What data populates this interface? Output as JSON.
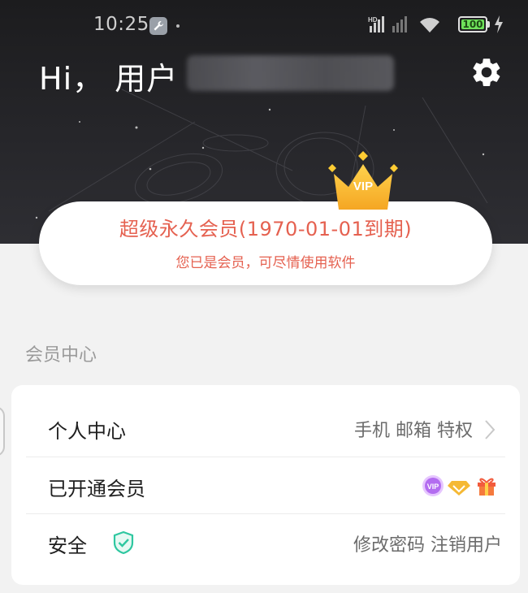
{
  "status_bar": {
    "time": "10:25",
    "battery": "100",
    "network_badge": "HD"
  },
  "header": {
    "greeting": "Hi，  用户",
    "icons": [
      "settings-icon"
    ]
  },
  "membership": {
    "title": "超级永久会员(1970-01-01到期)",
    "description": "您已是会员，可尽情使用软件",
    "crown_label": "VIP",
    "accent_color": "#e56150"
  },
  "section": {
    "title": "会员中心"
  },
  "list": {
    "items": [
      {
        "label": "个人中心",
        "right_text": "手机 邮箱 特权"
      },
      {
        "label": "已开通会员",
        "badges": [
          "vip-badge-icon",
          "diamond-badge-icon",
          "gift-badge-icon"
        ]
      },
      {
        "label": "安全",
        "right_text": "修改密码  注销用户"
      }
    ]
  }
}
